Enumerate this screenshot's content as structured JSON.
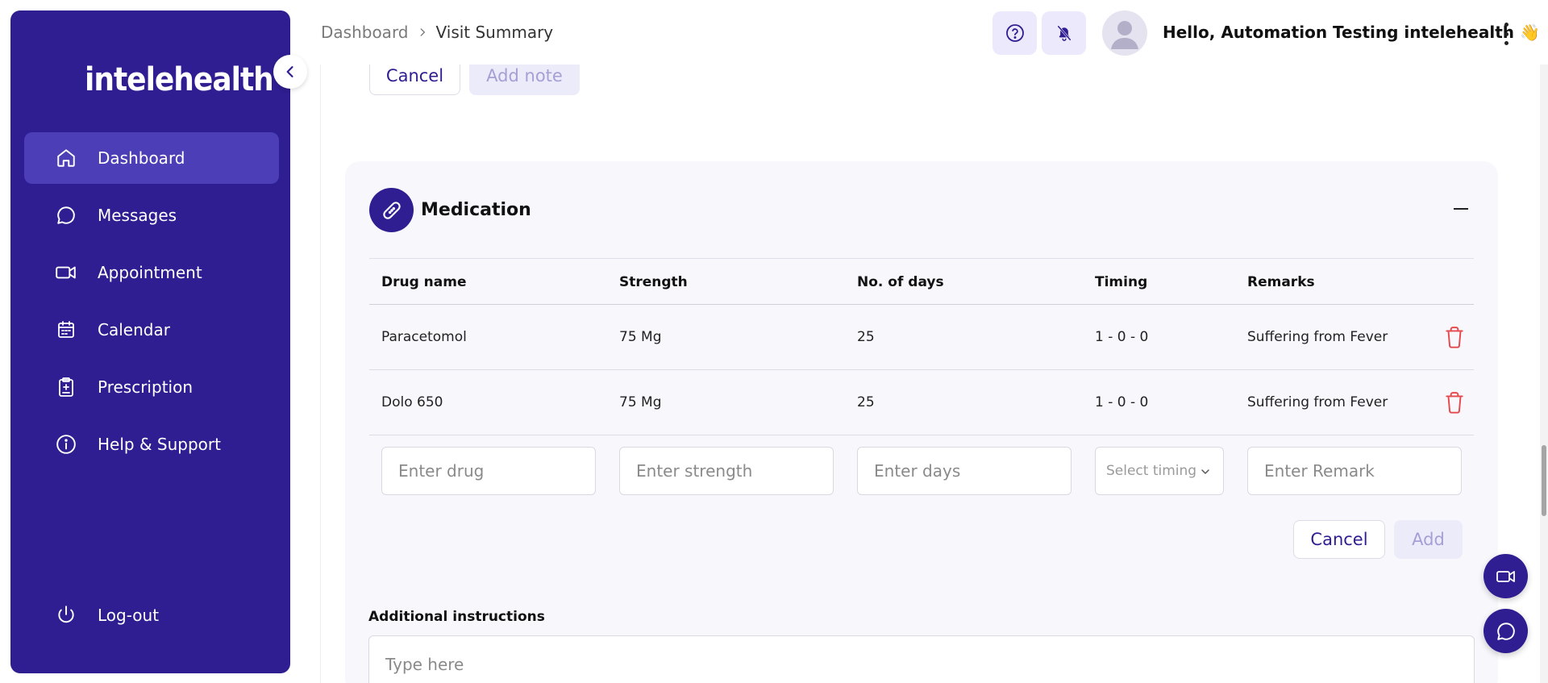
{
  "app": {
    "logo_text": "intelehealth"
  },
  "sidebar": {
    "items": [
      {
        "label": "Dashboard",
        "icon": "home-icon",
        "active": true
      },
      {
        "label": "Messages",
        "icon": "chat-icon",
        "active": false
      },
      {
        "label": "Appointment",
        "icon": "video-icon",
        "active": false
      },
      {
        "label": "Calendar",
        "icon": "calendar-icon",
        "active": false
      },
      {
        "label": "Prescription",
        "icon": "clipboard-icon",
        "active": false
      },
      {
        "label": "Help & Support",
        "icon": "info-icon",
        "active": false
      }
    ],
    "logout_label": "Log-out"
  },
  "header": {
    "breadcrumb": [
      "Dashboard",
      "Visit Summary"
    ],
    "greeting": "Hello, Automation Testing intelehealth",
    "greeting_emoji": "👋"
  },
  "note_actions": {
    "cancel_label": "Cancel",
    "add_label": "Add note"
  },
  "medication": {
    "title": "Medication",
    "columns": [
      "Drug name",
      "Strength",
      "No. of days",
      "Timing",
      "Remarks"
    ],
    "rows": [
      {
        "drug": "Paracetomol",
        "strength": "75 Mg",
        "days": "25",
        "timing": "1 - 0 - 0",
        "remarks": "Suffering from Fever"
      },
      {
        "drug": "Dolo 650",
        "strength": "75 Mg",
        "days": "25",
        "timing": "1 - 0 - 0",
        "remarks": "Suffering from Fever"
      }
    ],
    "inputs": {
      "drug_placeholder": "Enter drug",
      "strength_placeholder": "Enter strength",
      "days_placeholder": "Enter days",
      "timing_placeholder": "Select timing",
      "remark_placeholder": "Enter Remark"
    },
    "cancel_label": "Cancel",
    "add_label": "Add"
  },
  "additional_instructions": {
    "label": "Additional instructions",
    "placeholder": "Type here"
  },
  "colors": {
    "primary": "#2e1e91",
    "active_nav": "#4c3eb6",
    "danger": "#e5484d",
    "disabled_bg": "#ecebfa"
  }
}
